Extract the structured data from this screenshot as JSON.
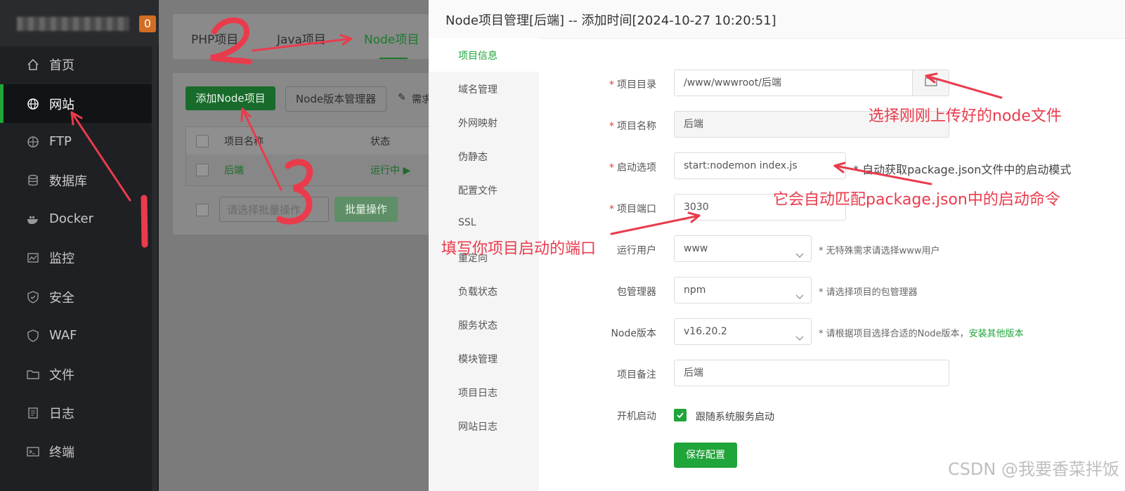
{
  "sidebar": {
    "badge": "0",
    "items": [
      {
        "label": "首页",
        "icon": "home-icon"
      },
      {
        "label": "网站",
        "icon": "globe-icon"
      },
      {
        "label": "FTP",
        "icon": "ftp-globe-icon"
      },
      {
        "label": "数据库",
        "icon": "database-icon"
      },
      {
        "label": "Docker",
        "icon": "docker-icon"
      },
      {
        "label": "监控",
        "icon": "monitor-icon"
      },
      {
        "label": "安全",
        "icon": "shield-icon"
      },
      {
        "label": "WAF",
        "icon": "waf-shield-icon"
      },
      {
        "label": "文件",
        "icon": "folder-icon"
      },
      {
        "label": "日志",
        "icon": "log-icon"
      },
      {
        "label": "终端",
        "icon": "terminal-icon"
      }
    ]
  },
  "main": {
    "tabs": [
      "PHP项目",
      "Java项目",
      "Node项目"
    ],
    "add_button": "添加Node项目",
    "version_button": "Node版本管理器",
    "extra_link": "需求",
    "columns": [
      "项目名称",
      "状态"
    ],
    "row": {
      "name": "后端",
      "status": "运行中 ▶"
    },
    "batch_placeholder": "请选择批量操作",
    "batch_button": "批量操作"
  },
  "dialog": {
    "title": "Node项目管理[后端] -- 添加时间[2024-10-27 10:20:51]",
    "nav": [
      "项目信息",
      "域名管理",
      "外网映射",
      "伪静态",
      "配置文件",
      "SSL",
      "重定向",
      "负载状态",
      "服务状态",
      "模块管理",
      "项目日志",
      "网站日志"
    ],
    "fields": {
      "dir": {
        "label": "项目目录",
        "value": "/www/wwwroot/后端"
      },
      "name": {
        "label": "项目名称",
        "value": "后端"
      },
      "start": {
        "label": "启动选项",
        "value": "start:nodemon index.js",
        "hint": "* 自动获取package.json文件中的启动模式"
      },
      "port": {
        "label": "项目端口",
        "value": "3030"
      },
      "user": {
        "label": "运行用户",
        "value": "www",
        "hint": "* 无特殊需求请选择www用户"
      },
      "pkg": {
        "label": "包管理器",
        "value": "npm",
        "hint": "* 请选择项目的包管理器"
      },
      "node": {
        "label": "Node版本",
        "value": "v16.20.2",
        "hint": "* 请根据项目选择合适的Node版本，",
        "link": "安装其他版本"
      },
      "note": {
        "label": "项目备注",
        "value": "后端"
      },
      "boot": {
        "label": "开机启动",
        "check_label": "跟随系统服务启动"
      }
    },
    "save": "保存配置"
  },
  "annotations": {
    "a1": "选择刚刚上传好的node文件",
    "a2": "它会自动匹配package.json中的启动命令",
    "a3": "填写你项目启动的端口",
    "n2": "2",
    "n3": "3",
    "n1": "1"
  },
  "watermark": "CSDN @我要香菜拌饭",
  "colors": {
    "accent": "#20a53a",
    "annotation": "#ea3b4c",
    "sidebar_bg": "#1f2023"
  }
}
